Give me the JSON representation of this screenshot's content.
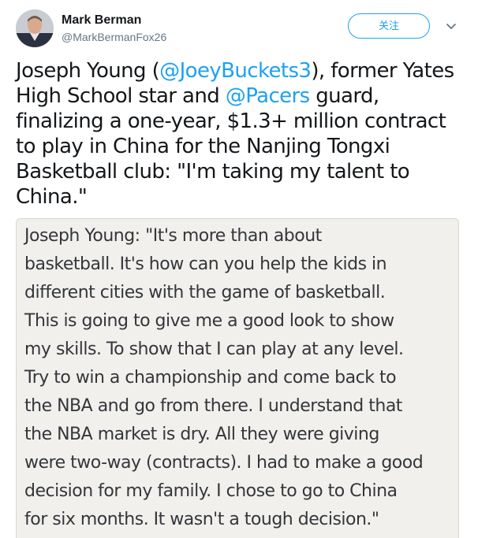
{
  "author": {
    "display_name": "Mark Berman",
    "handle": "@MarkBermanFox26",
    "avatar_icon": "person-avatar"
  },
  "follow_button": {
    "label": "关注"
  },
  "menu_icon": "chevron-down-icon",
  "tweet": {
    "lines": [
      {
        "pre": "Joseph Young (",
        "mention": "@JoeyBuckets3",
        "post": "), former Yates"
      },
      {
        "pre": "High School star and ",
        "mention": "@Pacers",
        "post": " guard,"
      },
      {
        "pre": "finalizing a one-year, $1.3+ million contract",
        "mention": "",
        "post": ""
      },
      {
        "pre": "to play in China for the Nanjing Tongxi",
        "mention": "",
        "post": ""
      },
      {
        "pre": "Basketball club: \"I'm taking my talent to",
        "mention": "",
        "post": ""
      },
      {
        "pre": "China.\"",
        "mention": "",
        "post": ""
      }
    ]
  },
  "quote_image": {
    "lines": [
      "Joseph Young: \"It's more than about",
      "basketball. It's how can you help the kids in",
      "different cities with the game of basketball.",
      "This is going to give me a good look to show",
      "my skills. To show that I can play at any level.",
      "Try to win a championship and come back to",
      "the NBA and go from there. I understand that",
      "the NBA market is dry. All they were giving",
      "were two-way (contracts). I had to make a good",
      "decision for my family. I chose to go to China",
      "for six months. It wasn't a tough decision.\""
    ]
  },
  "colors": {
    "link": "#1da1f2",
    "text": "#14171a",
    "secondary": "#657786"
  }
}
